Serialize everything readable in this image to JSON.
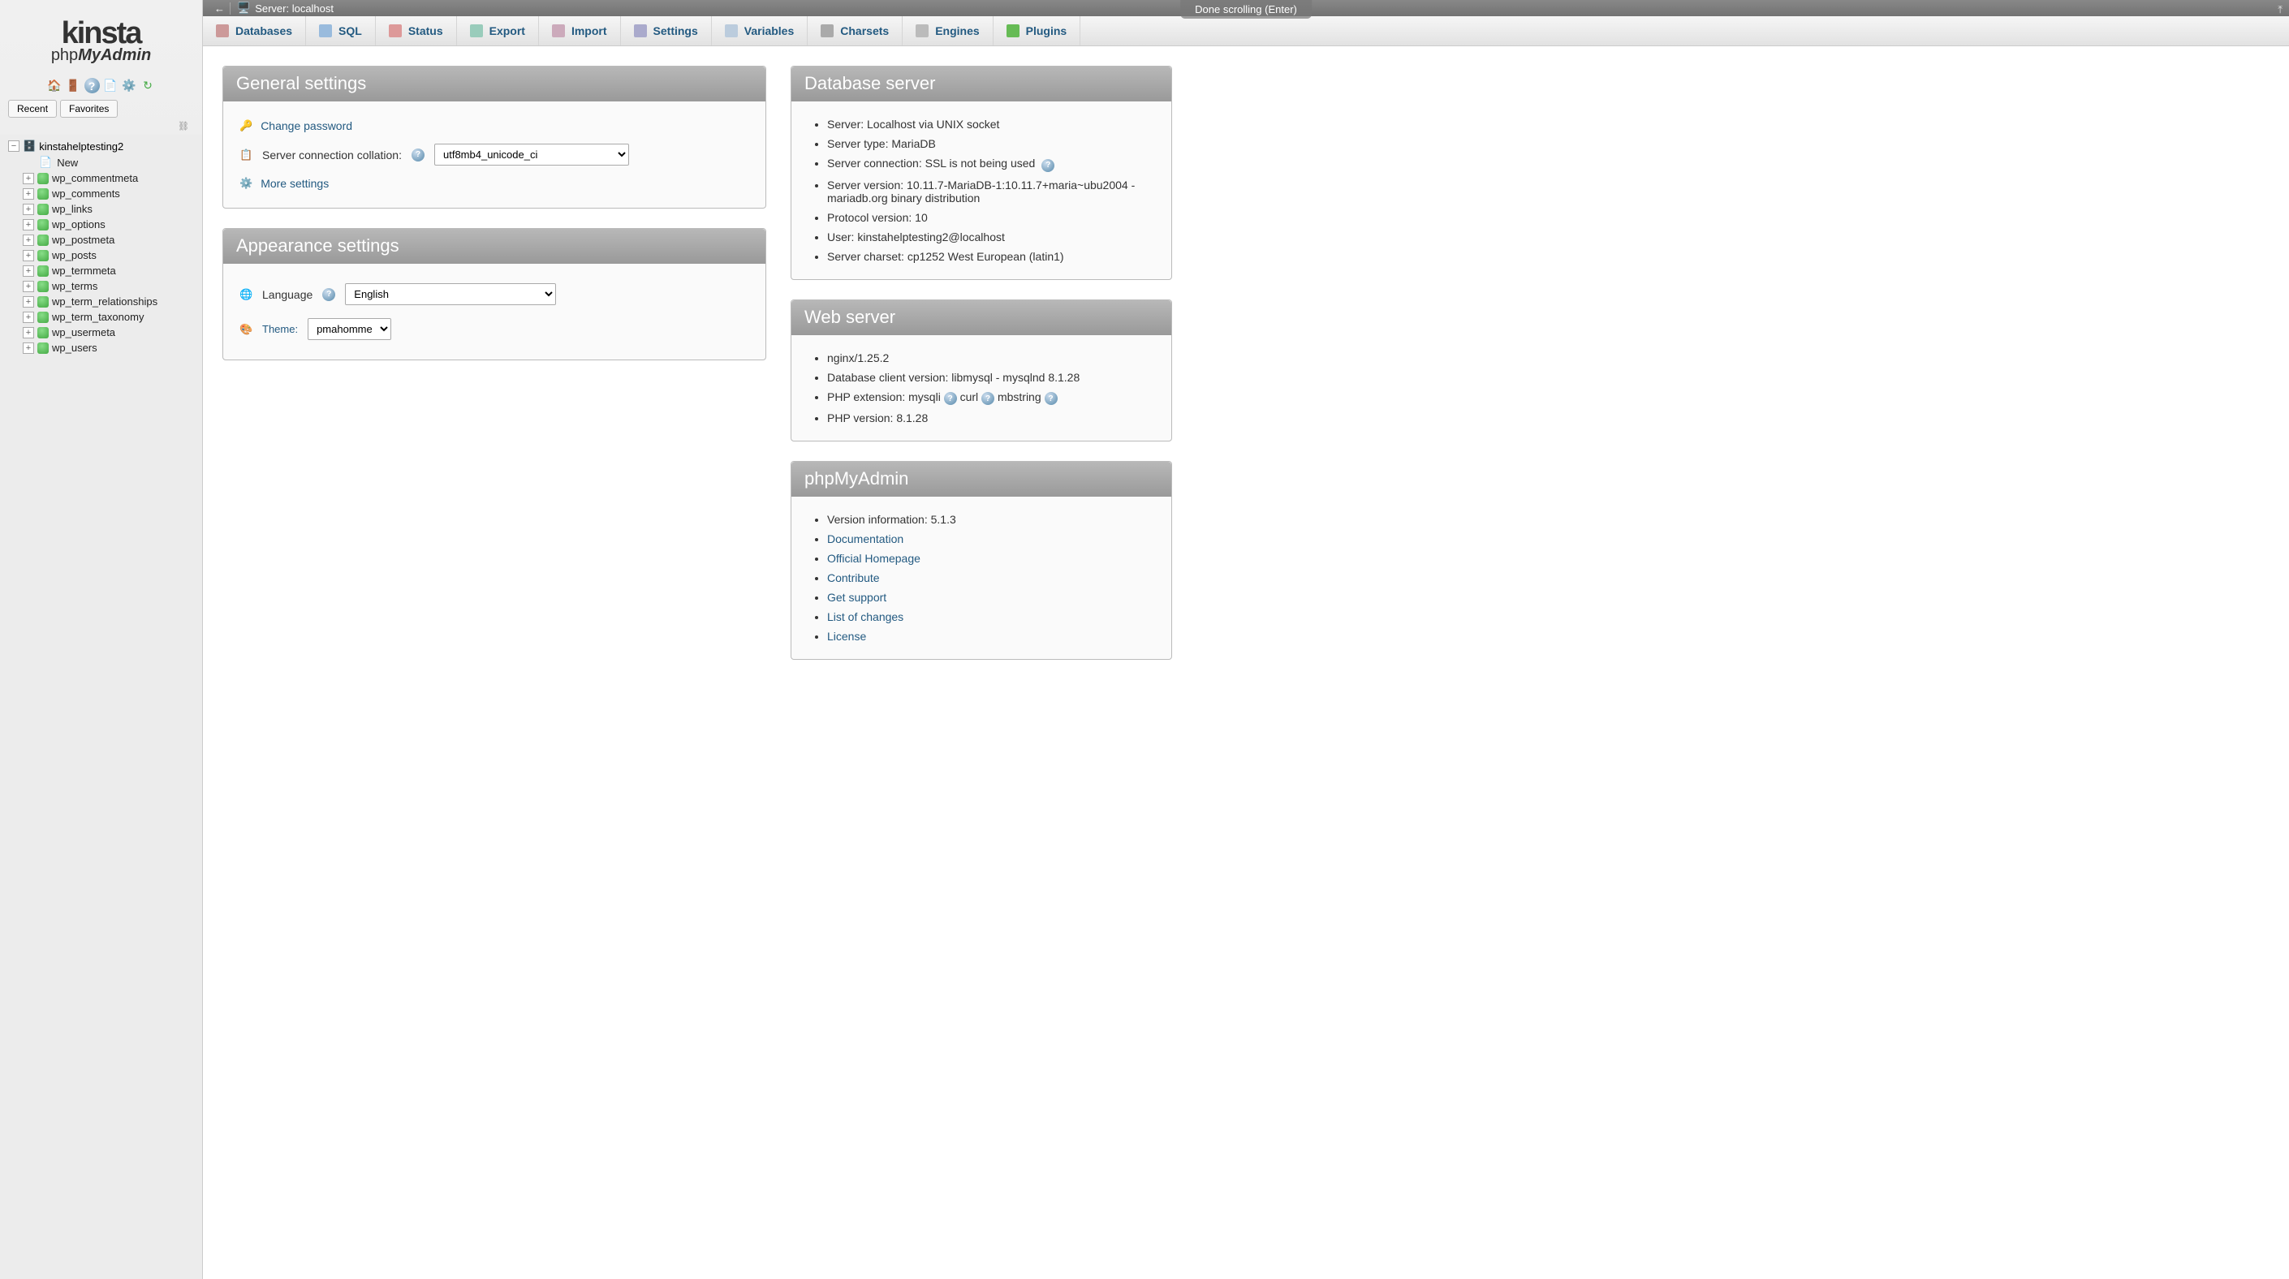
{
  "overlay": {
    "scroll_msg": "Done scrolling (Enter)"
  },
  "logo": {
    "brand": "kinsta",
    "pma_light": "php",
    "pma_bold": "MyAdmin"
  },
  "nav_tabs": {
    "recent": "Recent",
    "favorites": "Favorites"
  },
  "chain": "⛓",
  "tree": {
    "db": "kinstahelptesting2",
    "new_label": "New",
    "tables": [
      "wp_commentmeta",
      "wp_comments",
      "wp_links",
      "wp_options",
      "wp_postmeta",
      "wp_posts",
      "wp_termmeta",
      "wp_terms",
      "wp_term_relationships",
      "wp_term_taxonomy",
      "wp_usermeta",
      "wp_users"
    ]
  },
  "topbar": {
    "label": "Server: localhost"
  },
  "tabs": [
    {
      "label": "Databases",
      "color": "#c99"
    },
    {
      "label": "SQL",
      "color": "#9bd"
    },
    {
      "label": "Status",
      "color": "#d99"
    },
    {
      "label": "Export",
      "color": "#9cb"
    },
    {
      "label": "Import",
      "color": "#cab"
    },
    {
      "label": "Settings",
      "color": "#aac"
    },
    {
      "label": "Variables",
      "color": "#bcd"
    },
    {
      "label": "Charsets",
      "color": "#aaa"
    },
    {
      "label": "Engines",
      "color": "#bbb"
    },
    {
      "label": "Plugins",
      "color": "#6b5"
    }
  ],
  "general": {
    "title": "General settings",
    "change_pwd": "Change password",
    "collation_label": "Server connection collation:",
    "collation_value": "utf8mb4_unicode_ci",
    "more": "More settings"
  },
  "appearance": {
    "title": "Appearance settings",
    "lang_label": "Language",
    "lang_value": "English",
    "theme_label": "Theme:",
    "theme_value": "pmahomme"
  },
  "dbserver": {
    "title": "Database server",
    "items": [
      "Server: Localhost via UNIX socket",
      "Server type: MariaDB",
      "Server connection: SSL is not being used",
      "Server version: 10.11.7-MariaDB-1:10.11.7+maria~ubu2004 - mariadb.org binary distribution",
      "Protocol version: 10",
      "User: kinstahelptesting2@localhost",
      "Server charset: cp1252 West European (latin1)"
    ]
  },
  "webserver": {
    "title": "Web server",
    "nginx": "nginx/1.25.2",
    "client": "Database client version: libmysql - mysqlnd 8.1.28",
    "ext_label": "PHP extension:",
    "ext_mysqli": "mysqli",
    "ext_curl": "curl",
    "ext_mbstring": "mbstring",
    "php_ver": "PHP version: 8.1.28"
  },
  "pma": {
    "title": "phpMyAdmin",
    "version": "Version information: 5.1.3",
    "links": [
      "Documentation",
      "Official Homepage",
      "Contribute",
      "Get support",
      "List of changes",
      "License"
    ]
  }
}
